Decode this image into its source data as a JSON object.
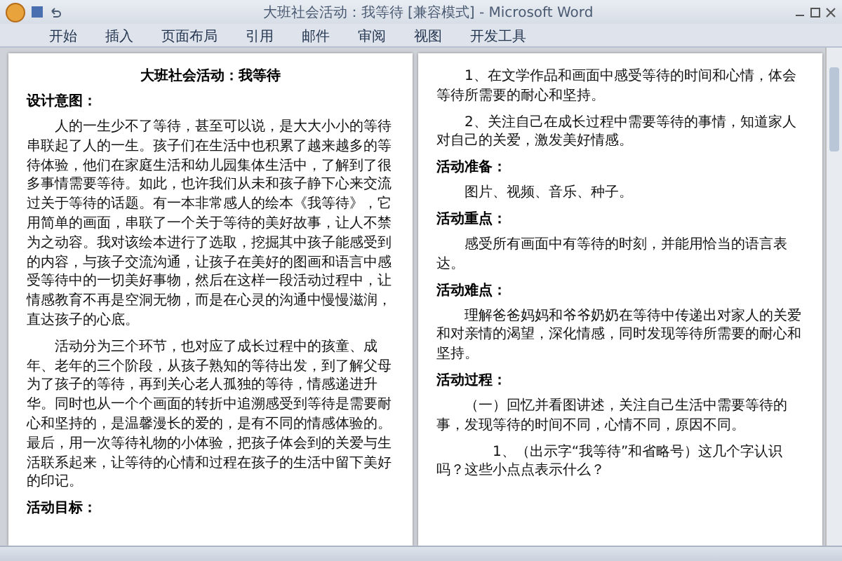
{
  "window": {
    "title": "大班社会活动：我等待 [兼容模式] - Microsoft Word"
  },
  "ribbon_tabs": [
    {
      "label": "开始",
      "selected": false
    },
    {
      "label": "插入",
      "selected": false
    },
    {
      "label": "页面布局",
      "selected": false
    },
    {
      "label": "引用",
      "selected": false
    },
    {
      "label": "邮件",
      "selected": false
    },
    {
      "label": "审阅",
      "selected": false
    },
    {
      "label": "视图",
      "selected": false
    },
    {
      "label": "开发工具",
      "selected": false
    }
  ],
  "pages": [
    {
      "blocks": [
        {
          "kind": "title",
          "text": "大班社会活动：我等待"
        },
        {
          "kind": "heading",
          "text": "设计意图："
        },
        {
          "kind": "paragraph",
          "text": "人的一生少不了等待，甚至可以说，是大大小小的等待串联起了人的一生。孩子们在生活中也积累了越来越多的等待体验，他们在家庭生活和幼儿园集体生活中，了解到了很多事情需要等待。如此，也许我们从未和孩子静下心来交流过关于等待的话题。有一本非常感人的绘本《我等待》，它用简单的画面，串联了一个关于等待的美好故事，让人不禁为之动容。我对该绘本进行了选取，挖掘其中孩子能感受到的内容，与孩子交流沟通，让孩子在美好的图画和语言中感受等待中的一切美好事物，然后在这样一段活动过程中，让情感教育不再是空洞无物，而是在心灵的沟通中慢慢滋润，直达孩子的心底。"
        },
        {
          "kind": "paragraph",
          "text": "活动分为三个环节，也对应了成长过程中的孩童、成年、老年的三个阶段，从孩子熟知的等待出发，到了解父母为了孩子的等待，再到关心老人孤独的等待，情感递进升华。同时也从一个个画面的转折中追溯感受到等待是需要耐心和坚持的，是温馨漫长的爱的，是有不同的情感体验的。最后，用一次等待礼物的小体验，把孩子体会到的关爱与生活联系起来，让等待的心情和过程在孩子的生活中留下美好的印记。"
        },
        {
          "kind": "heading",
          "text": "活动目标："
        }
      ]
    },
    {
      "blocks": [
        {
          "kind": "paragraph",
          "text": "1、在文学作品和画面中感受等待的时间和心情，体会等待所需要的耐心和坚持。"
        },
        {
          "kind": "paragraph",
          "text": "2、关注自己在成长过程中需要等待的事情，知道家人对自己的关爱，激发美好情感。"
        },
        {
          "kind": "heading",
          "text": "活动准备："
        },
        {
          "kind": "paragraph",
          "text": "图片、视频、音乐、种子。"
        },
        {
          "kind": "heading",
          "text": "活动重点："
        },
        {
          "kind": "paragraph",
          "text": "感受所有画面中有等待的时刻，并能用恰当的语言表达。"
        },
        {
          "kind": "heading",
          "text": "活动难点："
        },
        {
          "kind": "paragraph",
          "text": "理解爸爸妈妈和爷爷奶奶在等待中传递出对家人的关爱和对亲情的渴望，深化情感，同时发现等待所需要的耐心和坚持。"
        },
        {
          "kind": "heading",
          "text": "活动过程："
        },
        {
          "kind": "paragraph",
          "text": "（一）回忆并看图讲述，关注自己生活中需要等待的事，发现等待的时间不同，心情不同，原因不同。"
        },
        {
          "kind": "item",
          "text": "1、（出示字“我等待”和省略号）这几个字认识吗？这些小点点表示什么？"
        }
      ]
    }
  ]
}
